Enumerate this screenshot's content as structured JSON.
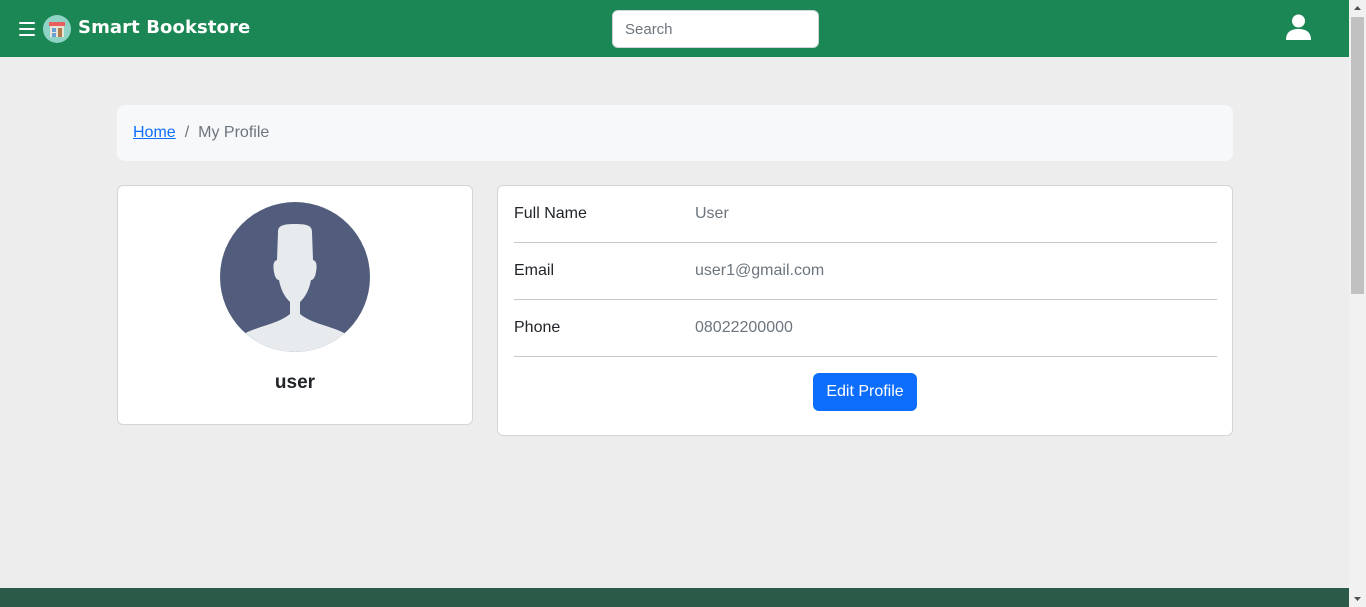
{
  "navbar": {
    "brand": "Smart Bookstore",
    "search_placeholder": "Search",
    "colors": {
      "background": "#1b8754",
      "text": "#ffffff"
    }
  },
  "breadcrumb": {
    "home": "Home",
    "separator": "/",
    "current": "My Profile"
  },
  "profile": {
    "name": "user"
  },
  "details": {
    "rows": [
      {
        "label": "Full Name",
        "value": "User"
      },
      {
        "label": "Email",
        "value": "user1@gmail.com"
      },
      {
        "label": "Phone",
        "value": "08022200000"
      }
    ],
    "edit_button": "Edit Profile"
  },
  "icons": {
    "menu": "hamburger-icon",
    "logo": "bookstore-logo-icon",
    "account": "user-icon",
    "avatar": "avatar-silhouette"
  },
  "colors": {
    "primary": "#0d6efd",
    "page_bg": "#ededed",
    "footer": "#2b5a48"
  }
}
